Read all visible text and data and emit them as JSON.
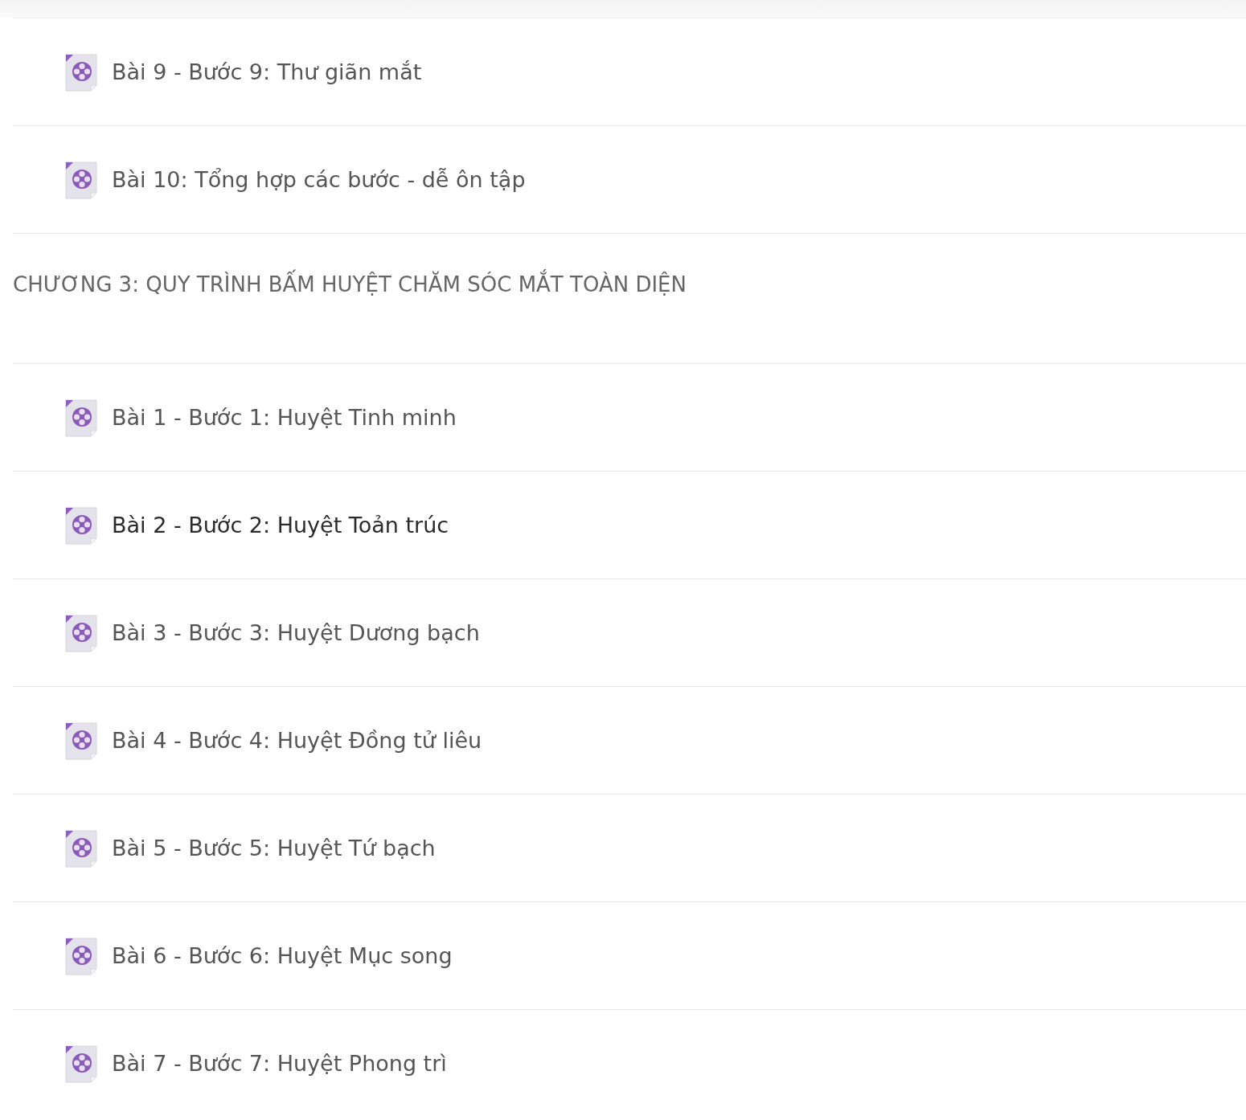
{
  "sections": [
    {
      "lessons": [
        {
          "title": "Bài 9 - Bước 9: Thư giãn mắt",
          "highlighted": false
        },
        {
          "title": "Bài 10: Tổng hợp các bước - dễ ôn tập",
          "highlighted": false
        }
      ]
    },
    {
      "title": "CHƯƠNG 3: QUY TRÌNH BẤM HUYỆT CHĂM SÓC MẮT TOÀN DIỆN",
      "lessons": [
        {
          "title": "Bài 1 - Bước 1: Huyệt Tinh minh",
          "highlighted": false
        },
        {
          "title": "Bài 2 - Bước 2: Huyệt Toản trúc",
          "highlighted": true
        },
        {
          "title": "Bài 3 - Bước 3: Huyệt Dương bạch",
          "highlighted": false
        },
        {
          "title": "Bài 4 - Bước 4: Huyệt Đồng tử liêu",
          "highlighted": false
        },
        {
          "title": "Bài 5 - Bước 5: Huyệt Tứ bạch",
          "highlighted": false
        },
        {
          "title": "Bài 6 - Bước 6: Huyệt Mục song",
          "highlighted": false
        },
        {
          "title": "Bài 7 - Bước 7: Huyệt Phong trì",
          "highlighted": false
        }
      ]
    }
  ]
}
